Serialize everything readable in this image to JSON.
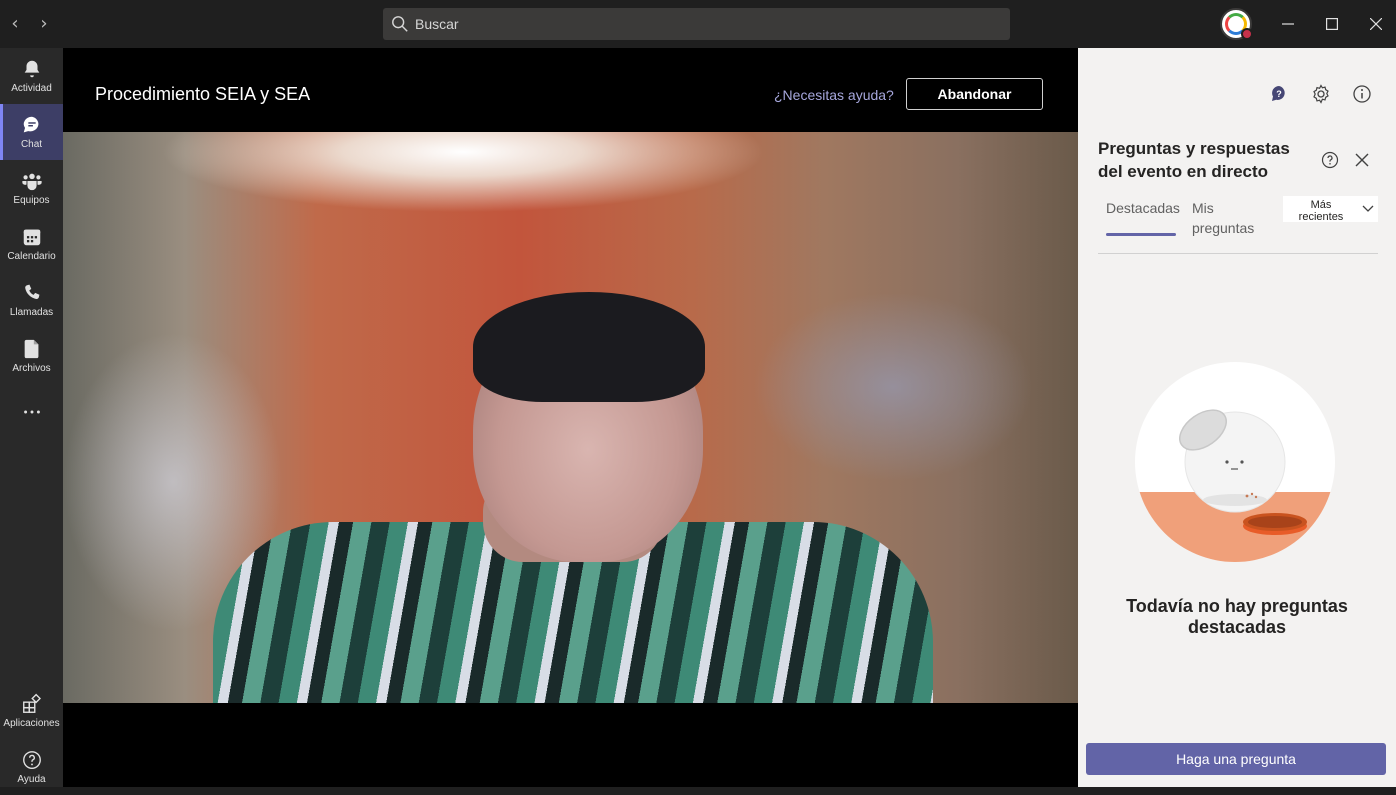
{
  "titlebar": {
    "back_icon": "chevron-left-icon",
    "forward_icon": "chevron-right-icon",
    "search_placeholder": "Buscar",
    "window_controls": [
      "minimize-icon",
      "maximize-icon",
      "close-icon"
    ]
  },
  "rail": {
    "items": [
      {
        "label": "Actividad",
        "icon": "bell-icon",
        "active": false
      },
      {
        "label": "Chat",
        "icon": "chat-icon",
        "active": true
      },
      {
        "label": "Equipos",
        "icon": "teams-icon",
        "active": false
      },
      {
        "label": "Calendario",
        "icon": "calendar-icon",
        "active": false
      },
      {
        "label": "Llamadas",
        "icon": "phone-icon",
        "active": false
      },
      {
        "label": "Archivos",
        "icon": "file-icon",
        "active": false
      }
    ],
    "more_icon": "more-icon",
    "bottom": [
      {
        "label": "Aplicaciones",
        "icon": "apps-icon"
      },
      {
        "label": "Ayuda",
        "icon": "help-icon"
      }
    ]
  },
  "meeting": {
    "title": "Procedimiento SEIA y SEA",
    "help_link": "¿Necesitas ayuda?",
    "leave_label": "Abandonar"
  },
  "qa_panel": {
    "title": "Preguntas y respuestas del evento en directo",
    "tabs": [
      {
        "label": "Destacadas",
        "active": true
      },
      {
        "label": "Mis preguntas",
        "active": false
      }
    ],
    "sort_label": "Más recientes",
    "empty_text": "Todavía no hay preguntas destacadas",
    "ask_button": "Haga una pregunta"
  },
  "colors": {
    "accent": "#6264a7",
    "rail_active": "#3d3e66",
    "illustration_orange": "#f0a07a"
  }
}
